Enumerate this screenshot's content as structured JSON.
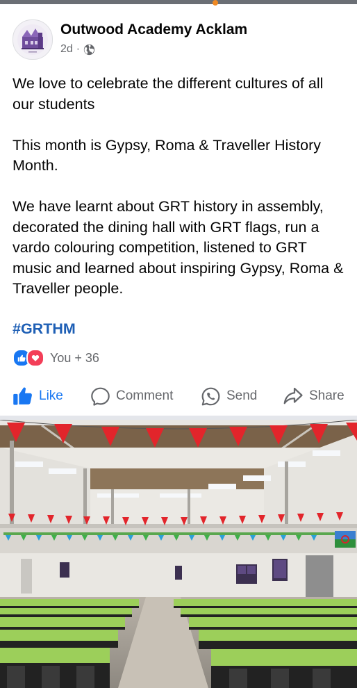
{
  "post": {
    "page_name": "Outwood Academy Acklam",
    "time": "2d",
    "separator": "·",
    "paragraphs": [
      "We love to celebrate the different cultures of all our students",
      "This month is Gypsy, Roma & Traveller History Month.",
      "We have learnt about GRT history in assembly, decorated the dining hall with GRT flags, run a vardo colouring competition, listened to GRT music and learned about inspiring Gypsy, Roma & Traveller people."
    ],
    "hashtag": "#GRTHM",
    "reactions_text": "You + 36"
  },
  "actions": {
    "like": "Like",
    "comment": "Comment",
    "send": "Send",
    "share": "Share"
  },
  "colors": {
    "accent": "#1877f2",
    "love": "#f33e58",
    "hashtag": "#1e5fb5",
    "muted": "#65676b"
  }
}
